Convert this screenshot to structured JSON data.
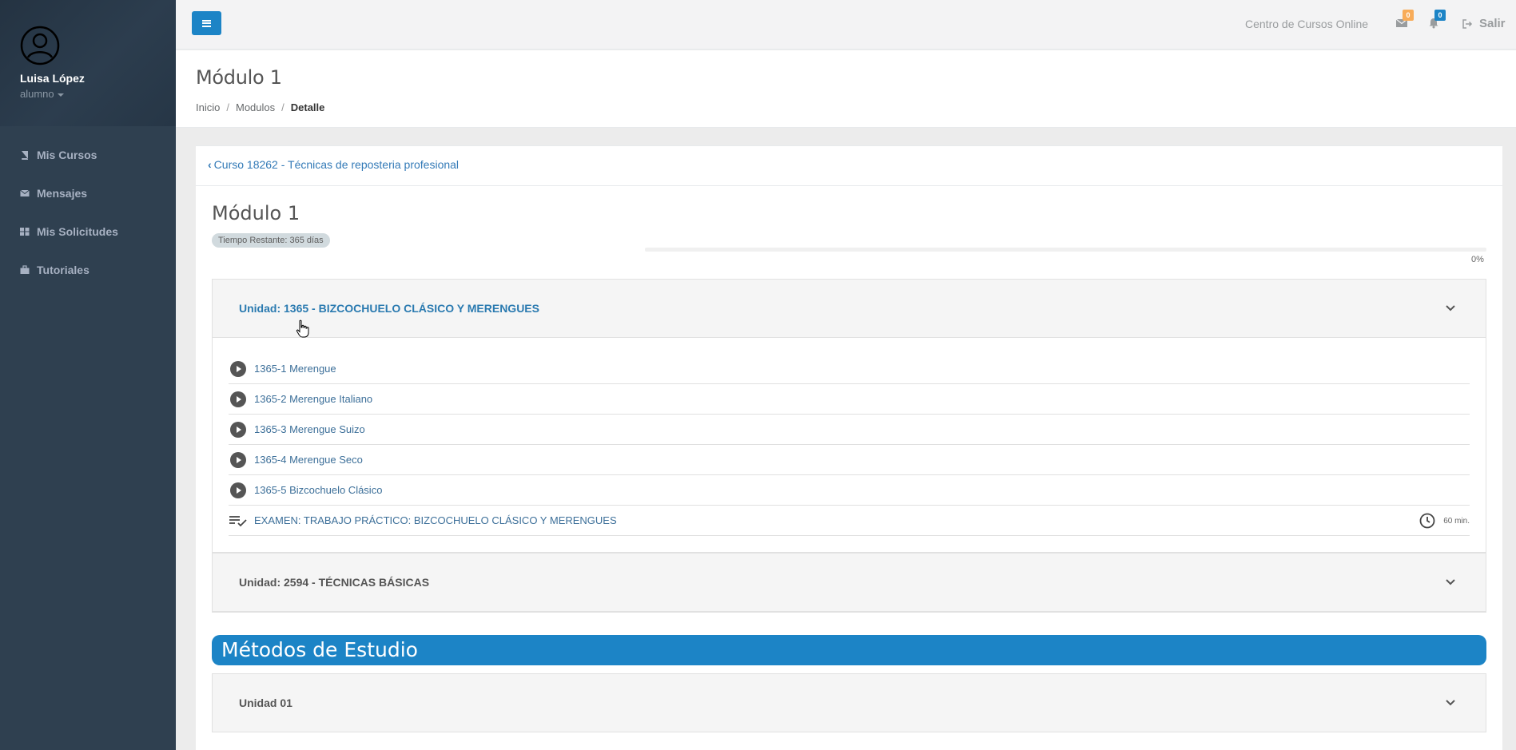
{
  "sidebar": {
    "user_name": "Luisa López",
    "user_role": "alumno",
    "items": [
      {
        "label": "Mis Cursos",
        "icon": "book-icon"
      },
      {
        "label": "Mensajes",
        "icon": "envelope-icon"
      },
      {
        "label": "Mis Solicitudes",
        "icon": "grid-icon"
      },
      {
        "label": "Tutoriales",
        "icon": "briefcase-icon"
      }
    ]
  },
  "topbar": {
    "title": "Centro de Cursos Online",
    "messages_count": "0",
    "notifications_count": "0",
    "logout_label": "Salir"
  },
  "heading": {
    "title": "Módulo 1",
    "breadcrumb": [
      "Inicio",
      "Modulos",
      "Detalle"
    ]
  },
  "course": {
    "back_link": "Curso 18262 - Técnicas de reposteria profesional",
    "module_title": "Módulo 1",
    "time_remaining": "Tiempo Restante: 365 días",
    "progress_percent": 0,
    "progress_label": "0%"
  },
  "units": [
    {
      "title": "Unidad: 1365 - BIZCOCHUELO CLÁSICO Y MERENGUES",
      "lessons": [
        "1365-1 Merengue",
        "1365-2 Merengue Italiano",
        "1365-3 Merengue Suizo",
        "1365-4 Merengue Seco",
        "1365-5 Bizcochuelo Clásico"
      ],
      "exam": {
        "label": "EXAMEN: TRABAJO PRÁCTICO: BIZCOCHUELO CLÁSICO Y MERENGUES",
        "duration": "60 min."
      }
    },
    {
      "title": "Unidad: 2594 - TÉCNICAS BÁSICAS"
    }
  ],
  "methods": {
    "title": "Métodos de Estudio",
    "units": [
      {
        "title": "Unidad 01"
      }
    ]
  },
  "colors": {
    "accent": "#1c84c6",
    "sidebar": "#2f4050",
    "link": "#337ab7"
  }
}
